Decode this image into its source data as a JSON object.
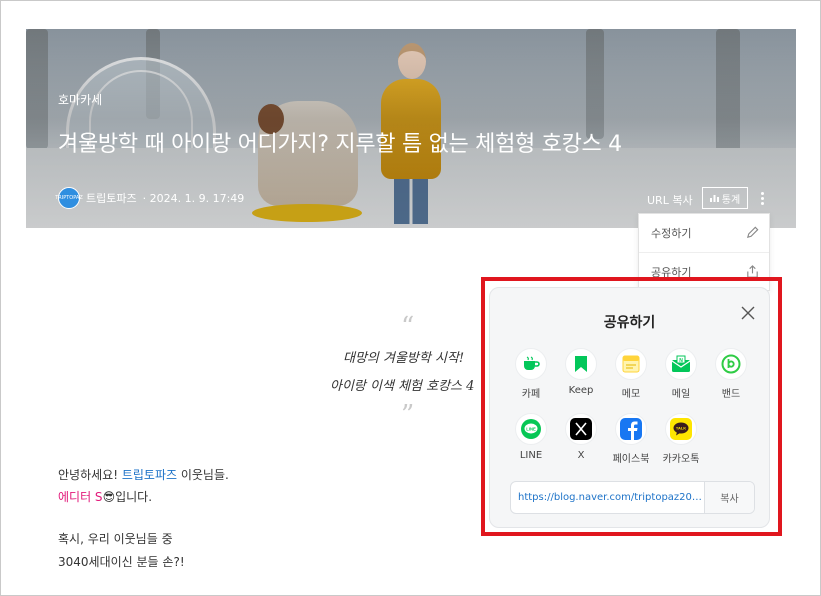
{
  "post": {
    "category": "호마카세",
    "title": "겨울방학 때 아이랑 어디가지? 지루할 틈 없는 체험형 호캉스 4",
    "author": "트립토파즈",
    "date": "· 2024. 1. 9. 17:49",
    "avatar_text": "TRIPTOPAZ",
    "url_copy": "URL 복사",
    "stats": "통계"
  },
  "menu": {
    "items": [
      {
        "label": "수정하기",
        "icon": "pencil-icon"
      },
      {
        "label": "공유하기",
        "icon": "share-icon"
      }
    ]
  },
  "quote": {
    "open": "“",
    "line1": "대망의 겨울방학 시작!",
    "line2": "아이랑 이색 체험 호캉스 4",
    "close": "”"
  },
  "body": {
    "l1_a": "안녕하세요! ",
    "l1_b": "트립토파즈",
    "l1_c": " 이웃님들.",
    "l2_a": "에디터 S",
    "l2_emoji": "😎",
    "l2_b": "입니다.",
    "l3": "혹시, 우리 이웃님들 중",
    "l4": "3040세대이신 분들 손?!"
  },
  "share": {
    "title": "공유하기",
    "apps": [
      {
        "label": "카페",
        "icon": "cafe-icon",
        "color": "#03c75a"
      },
      {
        "label": "Keep",
        "icon": "keep-icon",
        "color": "#03c75a"
      },
      {
        "label": "메모",
        "icon": "memo-icon",
        "color": "#ffd43b"
      },
      {
        "label": "메일",
        "icon": "mail-icon",
        "color": "#03c75a"
      },
      {
        "label": "밴드",
        "icon": "band-icon",
        "color": "#2fcc45"
      },
      {
        "label": "LINE",
        "icon": "line-icon",
        "color": "#06c755"
      },
      {
        "label": "X",
        "icon": "x-icon",
        "color": "#000000"
      },
      {
        "label": "페이스북",
        "icon": "facebook-icon",
        "color": "#1877f2"
      },
      {
        "label": "카카오톡",
        "icon": "kakaotalk-icon",
        "color": "#fee500"
      }
    ],
    "url": "https://blog.naver.com/triptopaz2020/...",
    "copy_label": "복사",
    "highlight_color": "#e0161e"
  }
}
